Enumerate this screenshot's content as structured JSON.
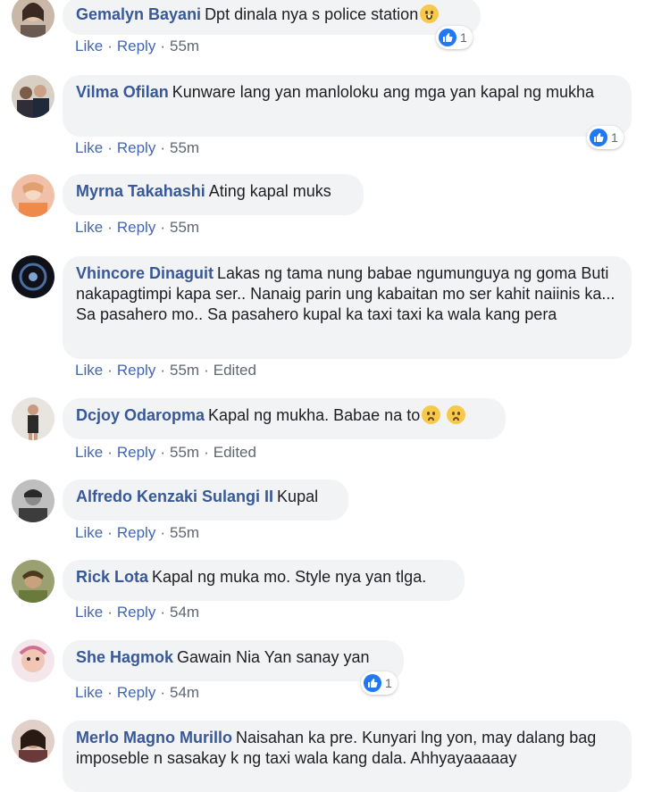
{
  "comments": [
    {
      "author": "Gemalyn Bayani",
      "text": "Dpt dinala nya s police station",
      "emoji_icons": [
        "rofl-emoji-icon"
      ],
      "actions": {
        "like": "Like",
        "reply": "Reply",
        "time": "55m"
      },
      "reaction_count": "1"
    },
    {
      "author": "Vilma Ofilan",
      "text": "Kunware lang yan manloloku ang mga yan kapal ng mukha",
      "actions": {
        "like": "Like",
        "reply": "Reply",
        "time": "55m"
      },
      "reaction_count": "1"
    },
    {
      "author": "Myrna Takahashi",
      "text": "Ating kapal muks",
      "actions": {
        "like": "Like",
        "reply": "Reply",
        "time": "55m"
      }
    },
    {
      "author": "Vhincore Dinaguit",
      "text": "Lakas ng tama nung babae ngumunguya ng goma Buti nakapagtimpi kapa ser.. Nanaig parin ung kabaitan mo ser kahit naiinis ka... Sa pasahero mo.. Sa pasahero kupal ka taxi taxi ka wala kang pera",
      "actions": {
        "like": "Like",
        "reply": "Reply",
        "time": "55m",
        "edited": "Edited"
      }
    },
    {
      "author": "Dcjoy Odaropma",
      "text": "Kapal ng mukha. Babae na to",
      "emoji_icons": [
        "worried-face-emoji-icon",
        "worried-face-emoji-icon"
      ],
      "actions": {
        "like": "Like",
        "reply": "Reply",
        "time": "55m",
        "edited": "Edited"
      }
    },
    {
      "author": "Alfredo Kenzaki Sulangi II",
      "text": "Kupal",
      "actions": {
        "like": "Like",
        "reply": "Reply",
        "time": "55m"
      }
    },
    {
      "author": "Rick Lota",
      "text": "Kapal ng muka mo. Style nya yan tlga.",
      "actions": {
        "like": "Like",
        "reply": "Reply",
        "time": "54m"
      }
    },
    {
      "author": "She Hagmok",
      "text": "Gawain Nia Yan sanay yan",
      "actions": {
        "like": "Like",
        "reply": "Reply",
        "time": "54m"
      },
      "reaction_count": "1"
    },
    {
      "author": "Merlo Magno Murillo",
      "text": "Naisahan ka pre. Kunyari lng yon, may dalang bag imposeble n sasakay k ng taxi wala kang dala. Ahhyayaaaaay"
    }
  ],
  "colors": {
    "author": "#385898",
    "action": "#4267b2",
    "bubble": "#f2f3f5",
    "like_blue": "#2078f4"
  },
  "icons": {
    "reaction": "like-thumbs-up-icon"
  }
}
